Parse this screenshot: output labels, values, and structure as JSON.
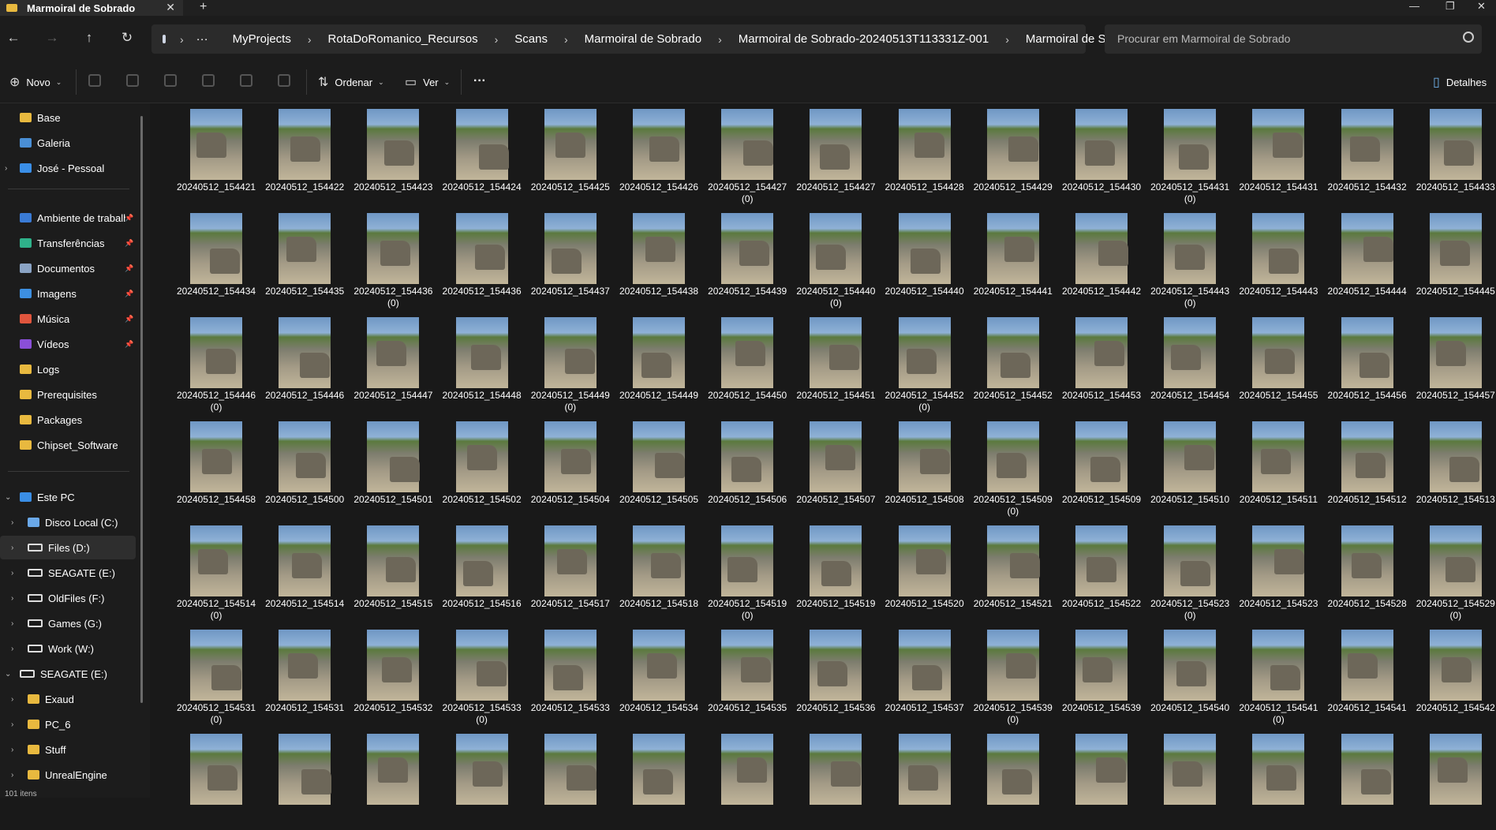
{
  "window": {
    "tab_title": "Marmoiral de Sobrado",
    "new_tab": "+",
    "close": "✕",
    "minimize": "—",
    "maximize": "❐",
    "close_window": "✕"
  },
  "breadcrumb": [
    "MyProjects",
    "RotaDoRomanico_Recursos",
    "Scans",
    "Marmoiral de Sobrado",
    "Marmoiral de Sobrado-20240513T113331Z-001",
    "Marmoiral de Sobrado"
  ],
  "breadcrumb_more": "···",
  "search": {
    "placeholder": "Procurar em Marmoiral de Sobrado"
  },
  "toolbar": {
    "new_label": "Novo",
    "sort_label": "Ordenar",
    "view_label": "Ver",
    "more": "···",
    "details_label": "Detalhes"
  },
  "sidebar": {
    "top": [
      {
        "label": "Base",
        "icon": "home-icon",
        "color": "#e8b93f"
      },
      {
        "label": "Galeria",
        "icon": "gallery-icon",
        "color": "#4a8fd6"
      },
      {
        "label": "José - Pessoal",
        "icon": "onedrive-icon",
        "color": "#3a8ee6"
      }
    ],
    "quick": [
      {
        "label": "Ambiente de trabalho",
        "icon": "desktop-icon",
        "color": "#3a7bd5",
        "pinned": true
      },
      {
        "label": "Transferências",
        "icon": "download-icon",
        "color": "#2fb28a",
        "pinned": true
      },
      {
        "label": "Documentos",
        "icon": "document-icon",
        "color": "#8aa3c4",
        "pinned": true
      },
      {
        "label": "Imagens",
        "icon": "pictures-icon",
        "color": "#3d8fe0",
        "pinned": true
      },
      {
        "label": "Música",
        "icon": "music-icon",
        "color": "#e0553d",
        "pinned": true
      },
      {
        "label": "Vídeos",
        "icon": "videos-icon",
        "color": "#8a4fd8",
        "pinned": true
      },
      {
        "label": "Logs",
        "icon": "folder-icon",
        "color": "#e8b93f",
        "pinned": false
      },
      {
        "label": "Prerequisites",
        "icon": "folder-icon",
        "color": "#e8b93f",
        "pinned": false
      },
      {
        "label": "Packages",
        "icon": "folder-icon",
        "color": "#e8b93f",
        "pinned": false
      },
      {
        "label": "Chipset_Software",
        "icon": "folder-icon",
        "color": "#e8b93f",
        "pinned": false
      }
    ],
    "this_pc": "Este PC",
    "drives": [
      {
        "label": "Disco Local (C:)",
        "icon": "windows-drive-icon"
      },
      {
        "label": "Files (D:)",
        "icon": "drive-icon"
      },
      {
        "label": "SEAGATE (E:)",
        "icon": "drive-icon"
      },
      {
        "label": "OldFiles (F:)",
        "icon": "drive-icon"
      },
      {
        "label": "Games (G:)",
        "icon": "drive-icon"
      },
      {
        "label": "Work (W:)",
        "icon": "drive-icon"
      }
    ],
    "seagate": "SEAGATE (E:)",
    "seagate_folders": [
      "Exaud",
      "PC_6",
      "Stuff",
      "UnrealEngine"
    ]
  },
  "files": [
    {
      "name": "20240512_154421"
    },
    {
      "name": "20240512_154422"
    },
    {
      "name": "20240512_154423"
    },
    {
      "name": "20240512_154424"
    },
    {
      "name": "20240512_154425"
    },
    {
      "name": "20240512_154426"
    },
    {
      "name": "20240512_154427",
      "sub": "(0)"
    },
    {
      "name": "20240512_154427"
    },
    {
      "name": "20240512_154428"
    },
    {
      "name": "20240512_154429"
    },
    {
      "name": "20240512_154430"
    },
    {
      "name": "20240512_154431",
      "sub": "(0)"
    },
    {
      "name": "20240512_154431"
    },
    {
      "name": "20240512_154432"
    },
    {
      "name": "20240512_154433"
    },
    {
      "name": "20240512_154434"
    },
    {
      "name": "20240512_154435"
    },
    {
      "name": "20240512_154436",
      "sub": "(0)"
    },
    {
      "name": "20240512_154436"
    },
    {
      "name": "20240512_154437"
    },
    {
      "name": "20240512_154438"
    },
    {
      "name": "20240512_154439"
    },
    {
      "name": "20240512_154440",
      "sub": "(0)"
    },
    {
      "name": "20240512_154440"
    },
    {
      "name": "20240512_154441"
    },
    {
      "name": "20240512_154442"
    },
    {
      "name": "20240512_154443",
      "sub": "(0)"
    },
    {
      "name": "20240512_154443"
    },
    {
      "name": "20240512_154444"
    },
    {
      "name": "20240512_154445"
    },
    {
      "name": "20240512_154446",
      "sub": "(0)"
    },
    {
      "name": "20240512_154446"
    },
    {
      "name": "20240512_154447"
    },
    {
      "name": "20240512_154448"
    },
    {
      "name": "20240512_154449",
      "sub": "(0)"
    },
    {
      "name": "20240512_154449"
    },
    {
      "name": "20240512_154450"
    },
    {
      "name": "20240512_154451"
    },
    {
      "name": "20240512_154452",
      "sub": "(0)"
    },
    {
      "name": "20240512_154452"
    },
    {
      "name": "20240512_154453"
    },
    {
      "name": "20240512_154454"
    },
    {
      "name": "20240512_154455"
    },
    {
      "name": "20240512_154456"
    },
    {
      "name": "20240512_154457"
    },
    {
      "name": "20240512_154458"
    },
    {
      "name": "20240512_154500"
    },
    {
      "name": "20240512_154501"
    },
    {
      "name": "20240512_154502"
    },
    {
      "name": "20240512_154504"
    },
    {
      "name": "20240512_154505"
    },
    {
      "name": "20240512_154506"
    },
    {
      "name": "20240512_154507"
    },
    {
      "name": "20240512_154508"
    },
    {
      "name": "20240512_154509",
      "sub": "(0)"
    },
    {
      "name": "20240512_154509"
    },
    {
      "name": "20240512_154510"
    },
    {
      "name": "20240512_154511"
    },
    {
      "name": "20240512_154512"
    },
    {
      "name": "20240512_154513"
    },
    {
      "name": "20240512_154514",
      "sub": "(0)"
    },
    {
      "name": "20240512_154514"
    },
    {
      "name": "20240512_154515"
    },
    {
      "name": "20240512_154516"
    },
    {
      "name": "20240512_154517"
    },
    {
      "name": "20240512_154518"
    },
    {
      "name": "20240512_154519",
      "sub": "(0)"
    },
    {
      "name": "20240512_154519"
    },
    {
      "name": "20240512_154520"
    },
    {
      "name": "20240512_154521"
    },
    {
      "name": "20240512_154522"
    },
    {
      "name": "20240512_154523",
      "sub": "(0)"
    },
    {
      "name": "20240512_154523"
    },
    {
      "name": "20240512_154528"
    },
    {
      "name": "20240512_154529",
      "sub": "(0)"
    },
    {
      "name": "20240512_154531",
      "sub": "(0)"
    },
    {
      "name": "20240512_154531"
    },
    {
      "name": "20240512_154532"
    },
    {
      "name": "20240512_154533",
      "sub": "(0)"
    },
    {
      "name": "20240512_154533"
    },
    {
      "name": "20240512_154534"
    },
    {
      "name": "20240512_154535"
    },
    {
      "name": "20240512_154536"
    },
    {
      "name": "20240512_154537"
    },
    {
      "name": "20240512_154539",
      "sub": "(0)"
    },
    {
      "name": "20240512_154539"
    },
    {
      "name": "20240512_154540"
    },
    {
      "name": "20240512_154541",
      "sub": "(0)"
    },
    {
      "name": "20240512_154541"
    },
    {
      "name": "20240512_154542"
    },
    {
      "name": ""
    },
    {
      "name": ""
    },
    {
      "name": ""
    },
    {
      "name": ""
    },
    {
      "name": ""
    },
    {
      "name": ""
    },
    {
      "name": ""
    },
    {
      "name": ""
    },
    {
      "name": ""
    },
    {
      "name": ""
    },
    {
      "name": ""
    },
    {
      "name": ""
    },
    {
      "name": ""
    },
    {
      "name": ""
    },
    {
      "name": ""
    }
  ],
  "status_bar": "101 itens"
}
